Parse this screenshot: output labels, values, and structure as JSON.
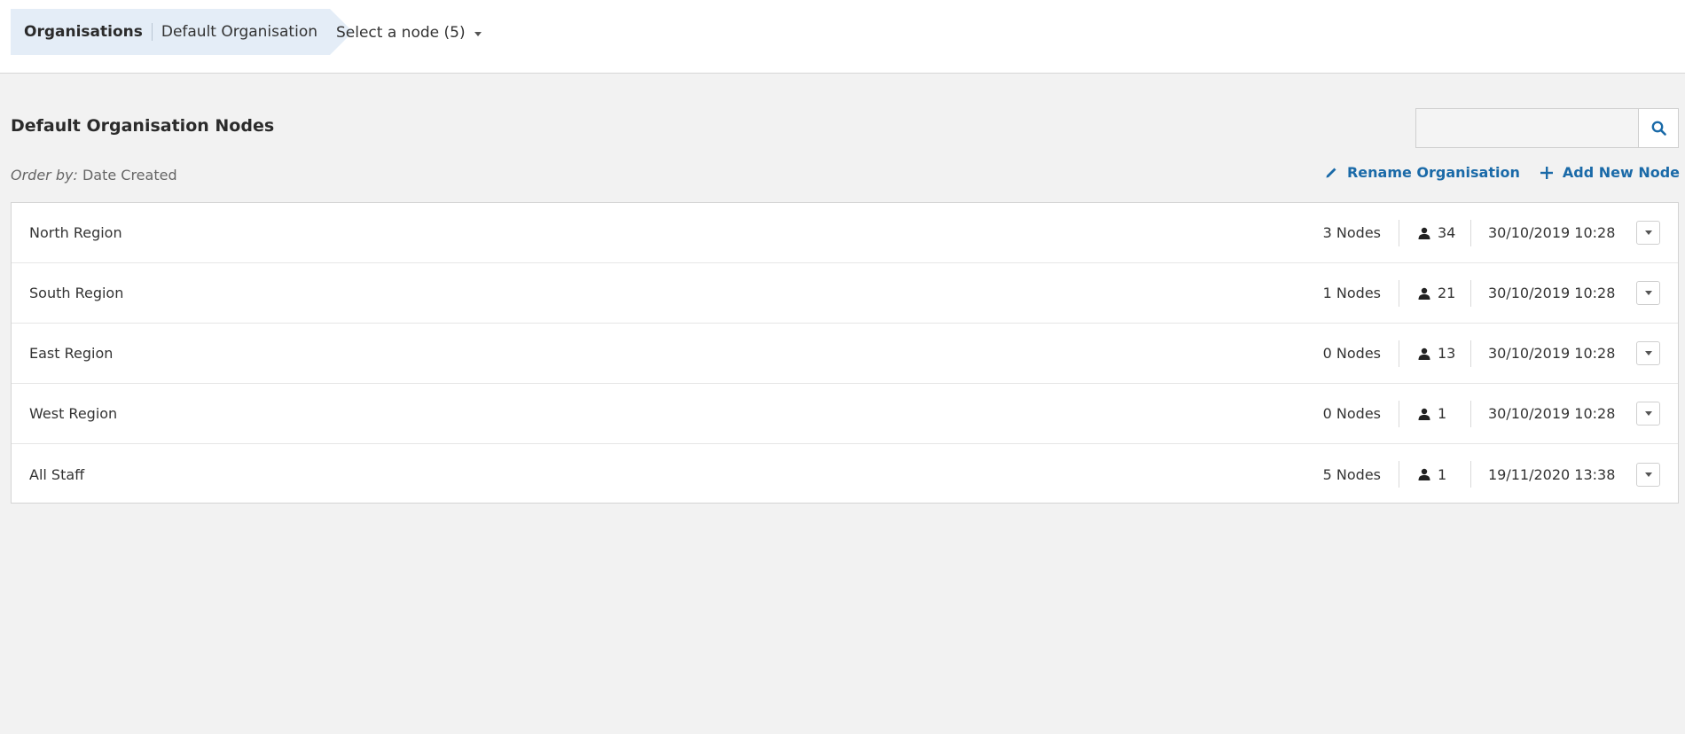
{
  "breadcrumb": {
    "root": "Organisations",
    "current": "Default Organisation"
  },
  "node_selector": {
    "label": "Select a node (5)"
  },
  "page": {
    "title": "Default Organisation Nodes"
  },
  "search": {
    "value": "",
    "placeholder": ""
  },
  "order": {
    "prefix": "Order by:",
    "value": "Date Created"
  },
  "actions": {
    "rename": "Rename Organisation",
    "add": "Add New Node"
  },
  "rows": [
    {
      "name": "North Region",
      "nodes": "3 Nodes",
      "users": "34",
      "date": "30/10/2019 10:28"
    },
    {
      "name": "South Region",
      "nodes": "1 Nodes",
      "users": "21",
      "date": "30/10/2019 10:28"
    },
    {
      "name": "East Region",
      "nodes": "0 Nodes",
      "users": "13",
      "date": "30/10/2019 10:28"
    },
    {
      "name": "West Region",
      "nodes": "0 Nodes",
      "users": "1",
      "date": "30/10/2019 10:28"
    },
    {
      "name": "All Staff",
      "nodes": "5 Nodes",
      "users": "1",
      "date": "19/11/2020 13:38"
    }
  ],
  "icons": {
    "search": "search-icon",
    "rename": "pencil-icon",
    "add": "plus-icon",
    "user": "user-icon",
    "dropdown": "chevron-down-icon"
  },
  "colors": {
    "accent": "#1a6aa8",
    "breadcrumb_bg": "#e4edf7",
    "page_bg": "#f2f2f2"
  }
}
